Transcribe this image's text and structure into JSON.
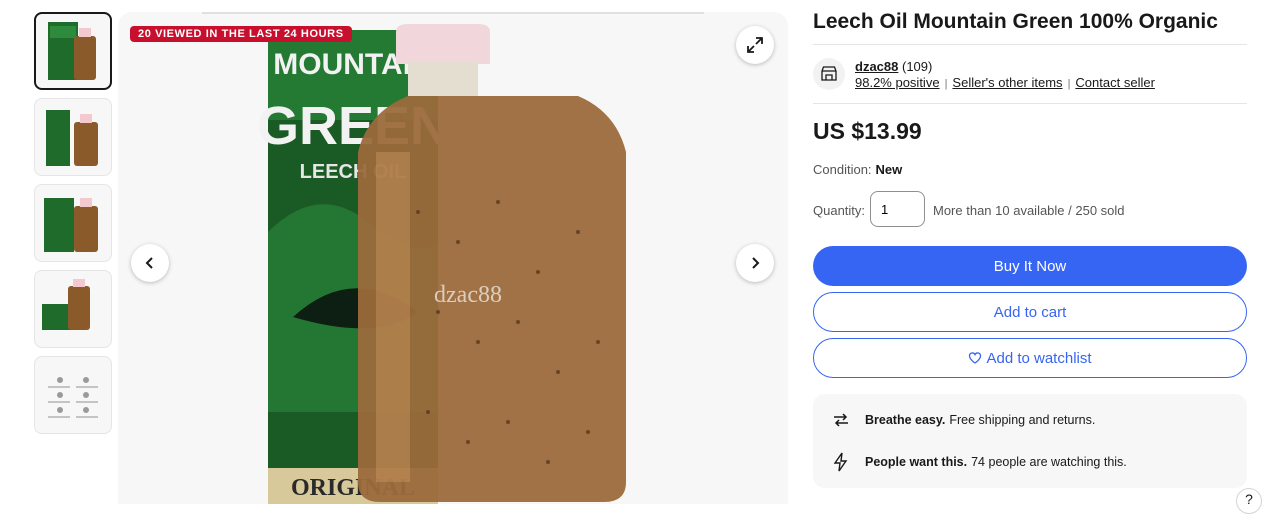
{
  "listing": {
    "title": "Leech Oil Mountain Green 100% Organic",
    "badge": "20 VIEWED IN THE LAST 24 HOURS",
    "watermark": "dzac88",
    "product_box_text": {
      "line1": "MOUNTAIN",
      "line2": "GREEN",
      "line3": "LEECH OIL",
      "line4": "ORIGINAL"
    }
  },
  "seller": {
    "name": "dzac88",
    "feedback_count": "(109)",
    "positive": "98.2% positive",
    "other_items": "Seller's other items",
    "contact": "Contact seller"
  },
  "price": "US $13.99",
  "condition": {
    "label": "Condition:",
    "value": "New"
  },
  "quantity": {
    "label": "Quantity:",
    "value": "1",
    "availability": "More than 10 available / 250 sold"
  },
  "buttons": {
    "buy_now": "Buy It Now",
    "add_to_cart": "Add to cart",
    "add_to_watchlist": "Add to watchlist"
  },
  "promos": [
    {
      "bold": "Breathe easy.",
      "text": "Free shipping and returns."
    },
    {
      "bold": "People want this.",
      "text": "74 people are watching this."
    }
  ],
  "help": "?",
  "colors": {
    "accent": "#3665f3",
    "badge": "#c8102e"
  }
}
